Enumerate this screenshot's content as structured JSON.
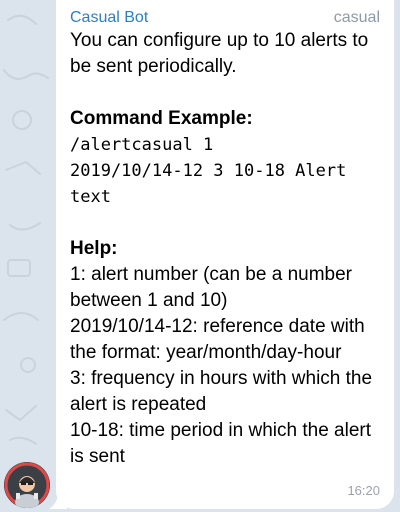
{
  "message": {
    "sender": "Casual Bot",
    "tag": "casual",
    "intro": "You can configure up to 10 alerts to be sent periodically.",
    "command_heading": "Command Example:",
    "command_lines": [
      "/alertcasual 1",
      "2019/10/14-12 3 10-18 Alert text"
    ],
    "help_heading": "Help:",
    "help_lines": [
      "1: alert number (can be a number between 1 and 10)",
      "2019/10/14-12: reference date with the format: year/month/day-hour",
      "3: frequency in hours with which the alert is repeated",
      "10-18: time period in which the alert is sent"
    ],
    "time": "16:20"
  },
  "colors": {
    "sender": "#2f7ec1",
    "tag": "#8e9aa6",
    "bubble": "#ffffff",
    "wallpaper": "#dbe4ec"
  },
  "icons": {
    "avatar": "bot-avatar"
  }
}
